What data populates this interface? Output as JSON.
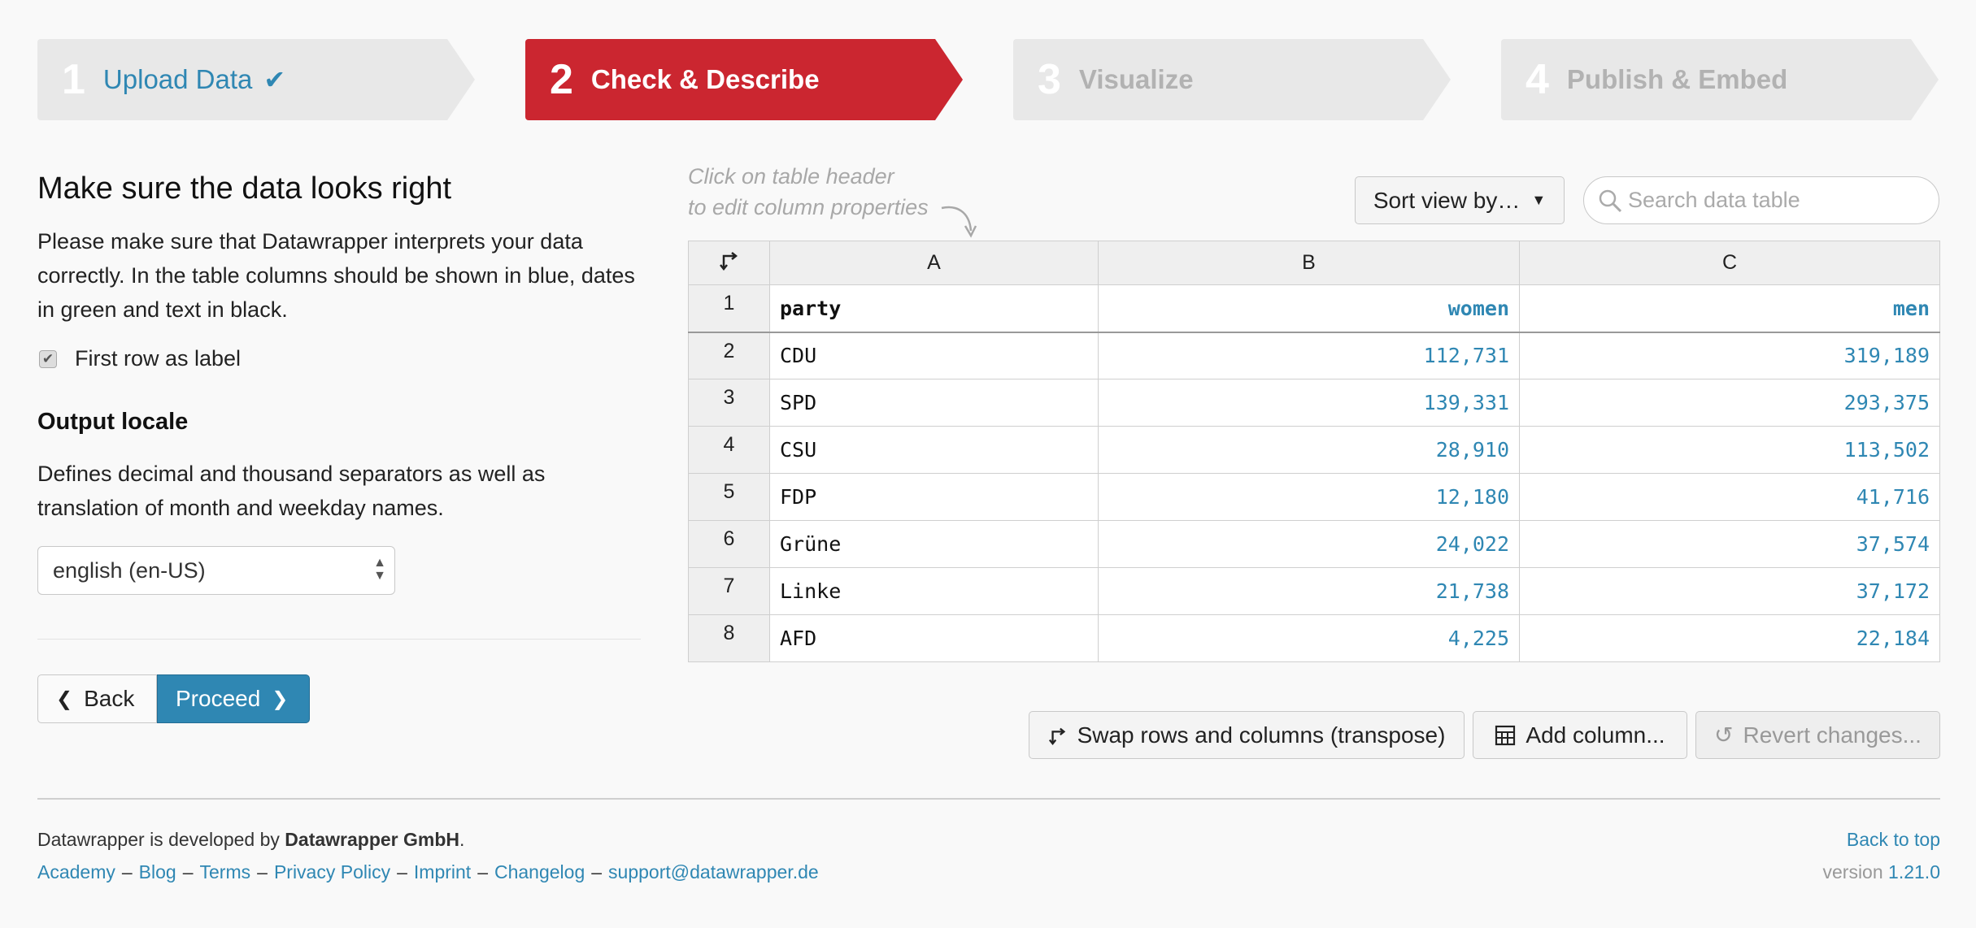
{
  "steps": [
    {
      "num": "1",
      "label": "Upload Data",
      "state": "done"
    },
    {
      "num": "2",
      "label": "Check & Describe",
      "state": "active"
    },
    {
      "num": "3",
      "label": "Visualize",
      "state": "todo"
    },
    {
      "num": "4",
      "label": "Publish & Embed",
      "state": "todo"
    }
  ],
  "left": {
    "title": "Make sure the data looks right",
    "description": "Please make sure that Datawrapper interprets your data correctly. In the table columns should be shown in blue, dates in green and text in black.",
    "first_row_label": "First row as label",
    "first_row_checked": true,
    "locale_title": "Output locale",
    "locale_description": "Defines decimal and thousand separators as well as translation of month and weekday names.",
    "locale_value": "english (en-US)",
    "back_label": "Back",
    "proceed_label": "Proceed"
  },
  "hint": {
    "line1": "Click on table header",
    "line2": "to edit column properties"
  },
  "toolbar": {
    "sort_label": "Sort view by…",
    "search_placeholder": "Search data table"
  },
  "table": {
    "columns": [
      "A",
      "B",
      "C"
    ],
    "rows": [
      {
        "n": "1",
        "cells": [
          "party",
          "women",
          "men"
        ]
      },
      {
        "n": "2",
        "cells": [
          "CDU",
          "112,731",
          "319,189"
        ]
      },
      {
        "n": "3",
        "cells": [
          "SPD",
          "139,331",
          "293,375"
        ]
      },
      {
        "n": "4",
        "cells": [
          "CSU",
          "28,910",
          "113,502"
        ]
      },
      {
        "n": "5",
        "cells": [
          "FDP",
          "12,180",
          "41,716"
        ]
      },
      {
        "n": "6",
        "cells": [
          "Grüne",
          "24,022",
          "37,574"
        ]
      },
      {
        "n": "7",
        "cells": [
          "Linke",
          "21,738",
          "37,172"
        ]
      },
      {
        "n": "8",
        "cells": [
          "AFD",
          "4,225",
          "22,184"
        ]
      }
    ]
  },
  "actions": {
    "transpose_label": "Swap rows and columns (transpose)",
    "add_column_label": "Add column...",
    "revert_label": "Revert changes..."
  },
  "footer": {
    "developed_by": "Datawrapper is developed by ",
    "company": "Datawrapper GmbH",
    "period": ".",
    "links": [
      "Academy",
      "Blog",
      "Terms",
      "Privacy Policy",
      "Imprint",
      "Changelog",
      "support@datawrapper.de"
    ],
    "back_to_top": "Back to top",
    "version_prefix": "version ",
    "version": "1.21.0"
  },
  "colors": {
    "accent": "#2f87b3",
    "active_step": "#cb2630",
    "inactive_step": "#e8e8e8"
  }
}
